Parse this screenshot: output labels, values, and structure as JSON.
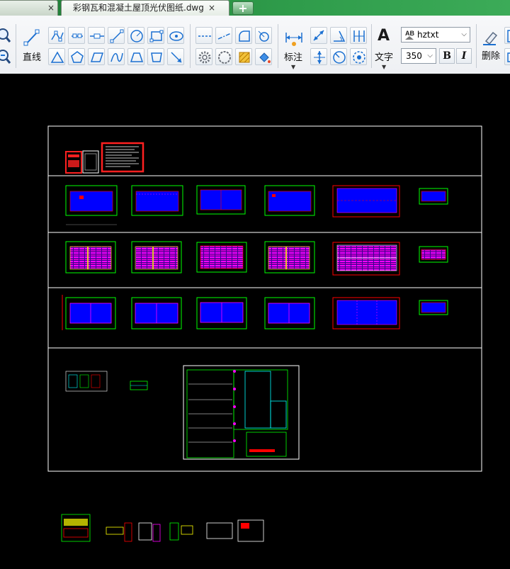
{
  "tabs": {
    "first_close": "×",
    "active_title": "彩钢瓦和混凝土屋顶光伏图纸.dwg",
    "active_close": "×",
    "new_tab": "+"
  },
  "ribbon": {
    "line_label": "直线",
    "dimension_label": "标注",
    "text_label": "文字",
    "text_icon": "A",
    "text_style": "hztxt",
    "text_height": "350",
    "bold": "B",
    "italic": "I",
    "delete_label": "删除"
  },
  "colors": {
    "tab_bar": "#2e9b4a",
    "ribbon": "#f3f4f6",
    "canvas": "#000000",
    "frame": "#ffffff",
    "plan_fill": "#0000ff",
    "plan_edge": "#00ff00",
    "accent_red": "#ff0000",
    "accent_magenta": "#ff00ff"
  }
}
